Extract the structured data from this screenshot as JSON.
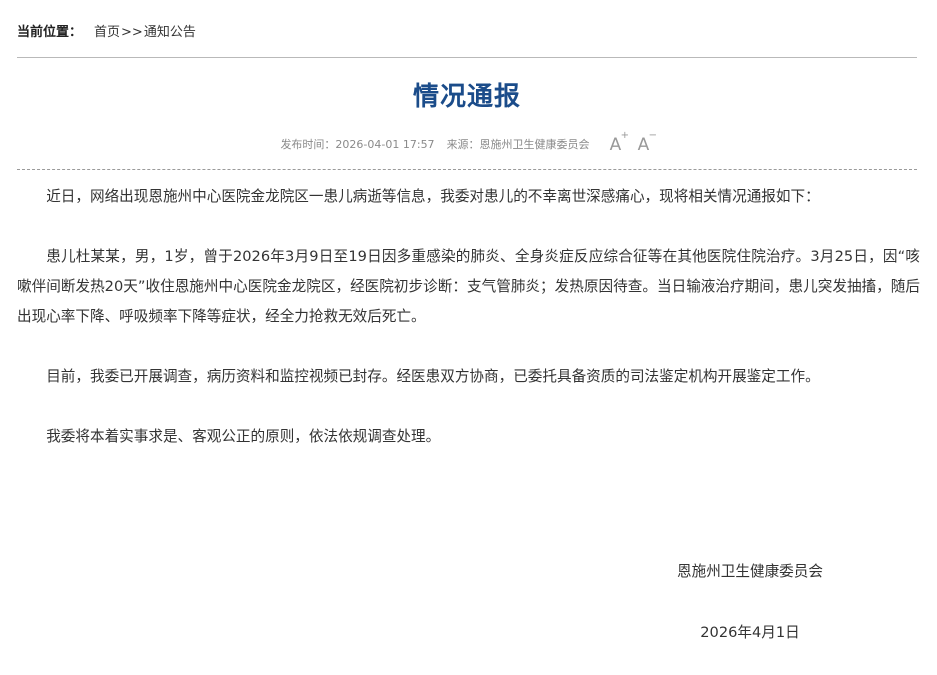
{
  "breadcrumb": {
    "label": "当前位置：",
    "home": "首页",
    "separator": ">>",
    "current": "通知公告"
  },
  "article": {
    "title": "情况通报",
    "meta": {
      "publish_time": "发布时间：2026-04-01 17:57",
      "source": "来源：恩施州卫生健康委员会",
      "font_increase": "A",
      "font_increase_sign": "+",
      "font_decrease": "A",
      "font_decrease_sign": "−"
    },
    "paragraphs": [
      "近日，网络出现恩施州中心医院金龙院区一患儿病逝等信息，我委对患儿的不幸离世深感痛心，现将相关情况通报如下：",
      "患儿杜某某，男，1岁，曾于2026年3月9日至19日因多重感染的肺炎、全身炎症反应综合征等在其他医院住院治疗。3月25日，因“咳嗽伴间断发热20天”收住恩施州中心医院金龙院区，经医院初步诊断：支气管肺炎；发热原因待查。当日输液治疗期间，患儿突发抽搐，随后出现心率下降、呼吸频率下降等症状，经全力抢救无效后死亡。",
      "目前，我委已开展调查，病历资料和监控视频已封存。经医患双方协商，已委托具备资质的司法鉴定机构开展鉴定工作。",
      "我委将本着实事求是、客观公正的原则，依法依规调查处理。"
    ],
    "signature": {
      "org": "恩施州卫生健康委员会",
      "date": "2026年4月1日"
    }
  },
  "colors": {
    "title": "#1b4c8a",
    "text": "#333333",
    "meta": "#8a8a8a",
    "rule": "#b9b9b9"
  }
}
